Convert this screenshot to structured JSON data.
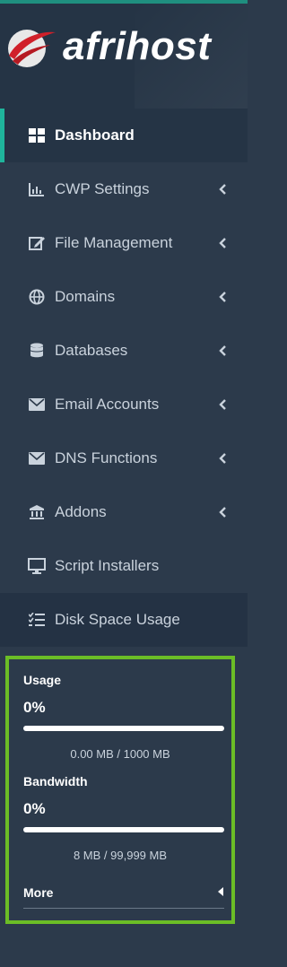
{
  "brand": {
    "name": "afrihost",
    "logo_icon": "afrihost-swoosh-logo"
  },
  "colors": {
    "sidebar_bg": "#2c3a4b",
    "active_bg": "#253445",
    "accent": "#1fb59c",
    "highlight_border": "#6bbd26",
    "text": "#c9d2dc"
  },
  "menu": [
    {
      "label": "Dashboard",
      "icon": "grid-icon",
      "active": true
    },
    {
      "label": "CWP Settings",
      "icon": "bar-chart-icon",
      "expandable": true
    },
    {
      "label": "File Management",
      "icon": "edit-icon",
      "expandable": true
    },
    {
      "label": "Domains",
      "icon": "globe-icon",
      "expandable": true
    },
    {
      "label": "Databases",
      "icon": "database-icon",
      "expandable": true
    },
    {
      "label": "Email Accounts",
      "icon": "envelope-icon",
      "expandable": true
    },
    {
      "label": "DNS Functions",
      "icon": "envelope-icon",
      "expandable": true
    },
    {
      "label": "Addons",
      "icon": "bank-icon",
      "expandable": true
    },
    {
      "label": "Script Installers",
      "icon": "monitor-icon"
    },
    {
      "label": "Disk Space Usage",
      "icon": "checklist-icon"
    }
  ],
  "stats": {
    "usage": {
      "title": "Usage",
      "percent": "0%",
      "fill": 0,
      "detail": "0.00 MB / 1000 MB"
    },
    "bandwidth": {
      "title": "Bandwidth",
      "percent": "0%",
      "fill": 0,
      "detail": "8 MB / 99,999 MB"
    },
    "more_label": "More"
  }
}
